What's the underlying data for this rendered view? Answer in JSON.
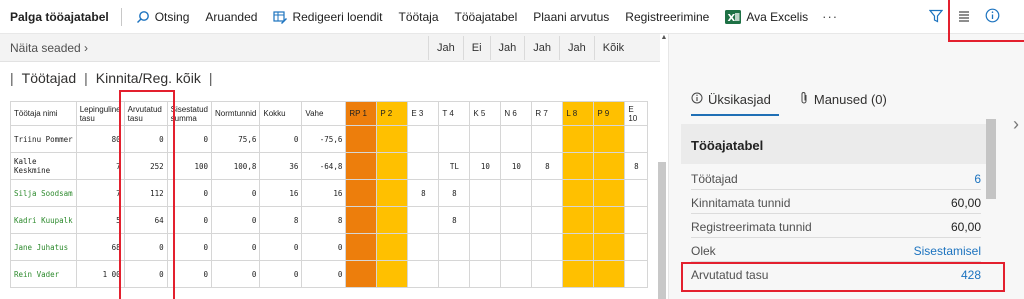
{
  "toolbar": {
    "title": "Palga tööajatabel",
    "search": "Otsing",
    "aruanded": "Aruanded",
    "redigeeri": "Redigeeri loendit",
    "tootaja": "Töötaja",
    "tooajatabel": "Tööajatabel",
    "plaani": "Plaani arvutus",
    "registreerimine": "Registreerimine",
    "excel": "Ava Excelis",
    "more": "···",
    "colors": {
      "excel_green": "#1e7145",
      "accent_blue": "#1c73bf",
      "highlight_red": "#e3202e"
    }
  },
  "filter": {
    "label": "Näita seaded",
    "buttons": [
      "Jah",
      "Ei",
      "Jah",
      "Jah",
      "Jah",
      "Kõik"
    ]
  },
  "links": {
    "employees": "Töötajad",
    "confirm_all": "Kinnita/Reg. kõik"
  },
  "grid": {
    "headers": [
      "Töötaja nimi",
      "Lepinguline tasu",
      "Arvutatud tasu",
      "Sisestatud summa",
      "Normtunnid",
      "Kokku",
      "Vahe",
      "RP 1",
      "P 2",
      "E 3",
      "T 4",
      "K 5",
      "N 6",
      "R 7",
      "L 8",
      "P 9",
      "E 10"
    ],
    "rows": [
      {
        "name": "Triinu Pommer",
        "green": false,
        "cells": [
          "80",
          "0",
          "0",
          "75,6",
          "0",
          "-75,6",
          "",
          "",
          "",
          "",
          "",
          "",
          "",
          "",
          "",
          ""
        ]
      },
      {
        "name": "Kalle Keskmine",
        "green": false,
        "cells": [
          "7",
          "252",
          "100",
          "100,8",
          "36",
          "-64,8",
          "",
          "",
          "",
          "TL",
          "10",
          "10",
          "8",
          "",
          "",
          "8"
        ]
      },
      {
        "name": "Silja Soodsam",
        "green": true,
        "cells": [
          "7",
          "112",
          "0",
          "0",
          "16",
          "16",
          "",
          "",
          "8",
          "8",
          "",
          "",
          "",
          "",
          "",
          ""
        ]
      },
      {
        "name": "Kadri Kuupalk",
        "green": true,
        "cells": [
          "5",
          "64",
          "0",
          "0",
          "8",
          "8",
          "",
          "",
          "",
          "8",
          "",
          "",
          "",
          "",
          "",
          ""
        ]
      },
      {
        "name": "Jane Juhatus",
        "green": true,
        "cells": [
          "68",
          "0",
          "0",
          "0",
          "0",
          "0",
          "",
          "",
          "",
          "",
          "",
          "",
          "",
          "",
          "",
          ""
        ]
      },
      {
        "name": "Rein Vader",
        "green": true,
        "cells": [
          "1 00",
          "0",
          "0",
          "0",
          "0",
          "0",
          "",
          "",
          "",
          "",
          "",
          "",
          "",
          "",
          "",
          ""
        ]
      }
    ]
  },
  "panel": {
    "tab_details": "Üksikasjad",
    "tab_attachments": "Manused (0)",
    "card_title": "Tööajatabel",
    "fields": [
      {
        "label": "Töötajad",
        "value": "6",
        "link": true
      },
      {
        "label": "Kinnitamata tunnid",
        "value": "60,00",
        "link": false
      },
      {
        "label": "Registreerimata tunnid",
        "value": "60,00",
        "link": false
      },
      {
        "label": "Olek",
        "value": "Sisestamisel",
        "link": true
      },
      {
        "label": "Arvutatud tasu",
        "value": "428",
        "link": true
      }
    ]
  }
}
